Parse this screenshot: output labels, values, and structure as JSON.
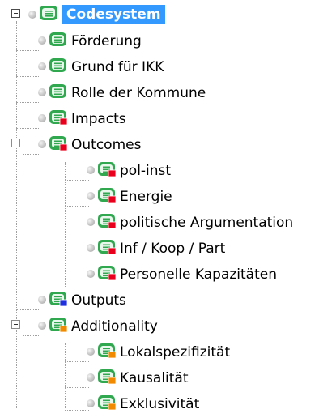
{
  "tree": {
    "root": {
      "label": "Codesystem",
      "icon": "codesystem-icon",
      "expanded": true
    },
    "items": [
      {
        "label": "Förderung",
        "marker_color": null
      },
      {
        "label": "Grund für IKK",
        "marker_color": null
      },
      {
        "label": "Rolle der Kommune",
        "marker_color": null
      },
      {
        "label": "Impacts",
        "marker_color": "#e8001c"
      },
      {
        "label": "Outcomes",
        "marker_color": "#e8001c",
        "expanded": true,
        "children": [
          {
            "label": "pol-inst",
            "marker_color": "#e8001c"
          },
          {
            "label": "Energie",
            "marker_color": "#e8001c"
          },
          {
            "label": "politische Argumentation",
            "marker_color": "#e8001c"
          },
          {
            "label": "Inf / Koop / Part",
            "marker_color": "#e8001c"
          },
          {
            "label": "Personelle Kapazitäten",
            "marker_color": "#e8001c"
          }
        ]
      },
      {
        "label": "Outputs",
        "marker_color": "#1f2fe0"
      },
      {
        "label": "Additionality",
        "marker_color": "#f28a00",
        "expanded": true,
        "children": [
          {
            "label": "Lokalspezifizität",
            "marker_color": "#f28a00"
          },
          {
            "label": "Kausalität",
            "marker_color": "#f28a00"
          },
          {
            "label": "Exklusivität",
            "marker_color": "#f28a00"
          }
        ]
      }
    ]
  },
  "colors": {
    "selection": "#3399ff",
    "code_icon_green": "#2fa84f",
    "tree_line": "#a0a0a0"
  }
}
